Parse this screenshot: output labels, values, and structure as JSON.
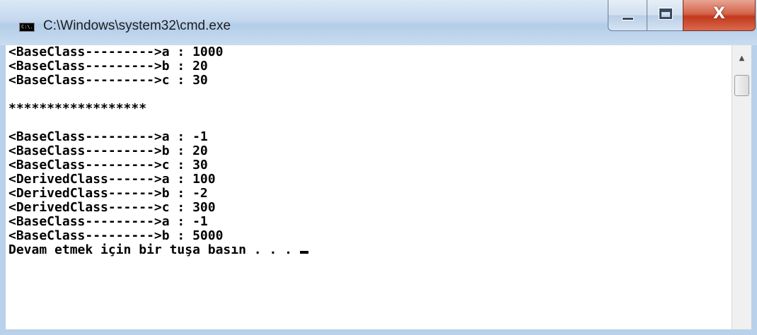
{
  "window": {
    "title": "C:\\Windows\\system32\\cmd.exe",
    "icon_text": "C:\\.",
    "icon": "cmd-icon",
    "close_glyph": "X"
  },
  "console": {
    "lines": [
      "<BaseClass--------->a : 1000",
      "<BaseClass--------->b : 20",
      "<BaseClass--------->c : 30",
      "",
      "******************",
      "",
      "<BaseClass--------->a : -1",
      "<BaseClass--------->b : 20",
      "<BaseClass--------->c : 30",
      "<DerivedClass------>a : 100",
      "<DerivedClass------>b : -2",
      "<DerivedClass------>c : 300",
      "<BaseClass--------->a : -1",
      "<BaseClass--------->b : 5000",
      "Devam etmek için bir tuşa basın . . . "
    ]
  },
  "scrollbar": {
    "up_arrow": "▲"
  },
  "colors": {
    "console_bg": "#ffffff",
    "console_text": "#000000",
    "frame": "#b9d1ea",
    "close": "#c2391d"
  }
}
